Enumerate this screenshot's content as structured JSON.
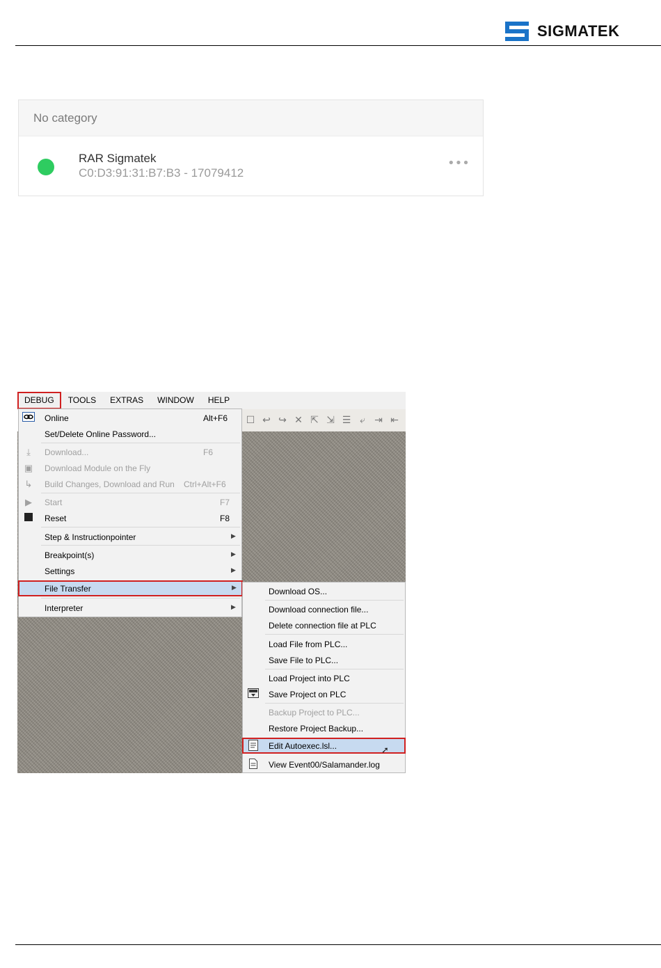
{
  "header": {
    "logo_text": "SIGMATEK"
  },
  "device_card": {
    "category": "No category",
    "device_name": "RAR Sigmatek",
    "device_id": "C0:D3:91:31:B7:B3 - 17079412",
    "more_glyph": "•••",
    "status_color": "#2ecc60"
  },
  "ide": {
    "menubar": [
      "DEBUG",
      "TOOLS",
      "EXTRAS",
      "WINDOW",
      "HELP"
    ],
    "debug_menu": {
      "online": {
        "label": "Online",
        "shortcut": "Alt+F6"
      },
      "password": {
        "label": "Set/Delete Online Password..."
      },
      "download": {
        "label": "Download...",
        "shortcut": "F6"
      },
      "download_module": {
        "label": "Download Module on the Fly"
      },
      "build_changes": {
        "label": "Build Changes, Download and Run",
        "shortcut": "Ctrl+Alt+F6"
      },
      "start": {
        "label": "Start",
        "shortcut": "F7"
      },
      "reset": {
        "label": "Reset",
        "shortcut": "F8"
      },
      "step": {
        "label": "Step & Instructionpointer"
      },
      "breakpoints": {
        "label": "Breakpoint(s)"
      },
      "settings": {
        "label": "Settings"
      },
      "file_transfer": {
        "label": "File Transfer"
      },
      "interpreter": {
        "label": "Interpreter"
      }
    },
    "file_transfer_menu": {
      "download_os": "Download OS...",
      "download_conn": "Download connection file...",
      "delete_conn": "Delete connection file at PLC",
      "load_file": "Load File from PLC...",
      "save_file": "Save File to PLC...",
      "load_project": "Load Project into PLC",
      "save_project": "Save Project on PLC",
      "backup_project": "Backup Project to PLC...",
      "restore_backup": "Restore Project Backup...",
      "edit_autoexec": "Edit Autoexec.lsl...",
      "view_event": "View Event00/Salamander.log"
    }
  }
}
